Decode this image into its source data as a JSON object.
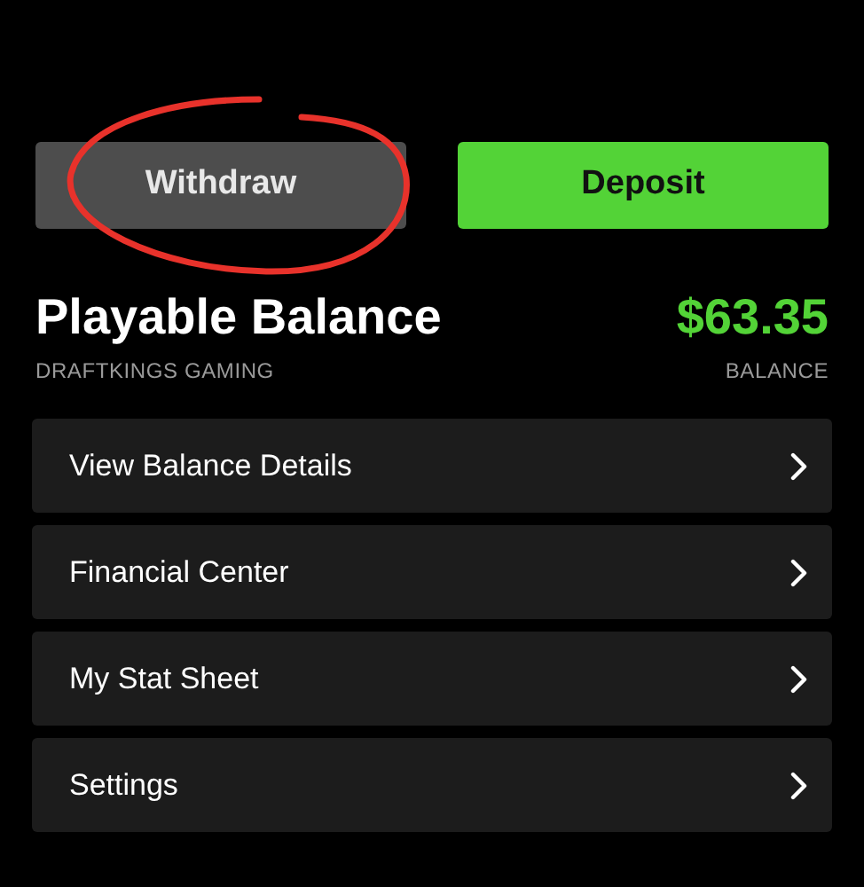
{
  "buttons": [
    {
      "label": "Withdraw",
      "kind": "secondary"
    },
    {
      "label": "Deposit",
      "kind": "primary"
    }
  ],
  "balance": {
    "title": "Playable Balance",
    "subtitle": "DRAFTKINGS GAMING",
    "amount": "$63.35",
    "amount_label": "BALANCE"
  },
  "menu": [
    {
      "label": "View Balance Details"
    },
    {
      "label": "Financial Center"
    },
    {
      "label": "My Stat Sheet"
    },
    {
      "label": "Settings"
    }
  ],
  "annotations": [
    {
      "kind": "circle",
      "color": "#e8322b"
    }
  ]
}
